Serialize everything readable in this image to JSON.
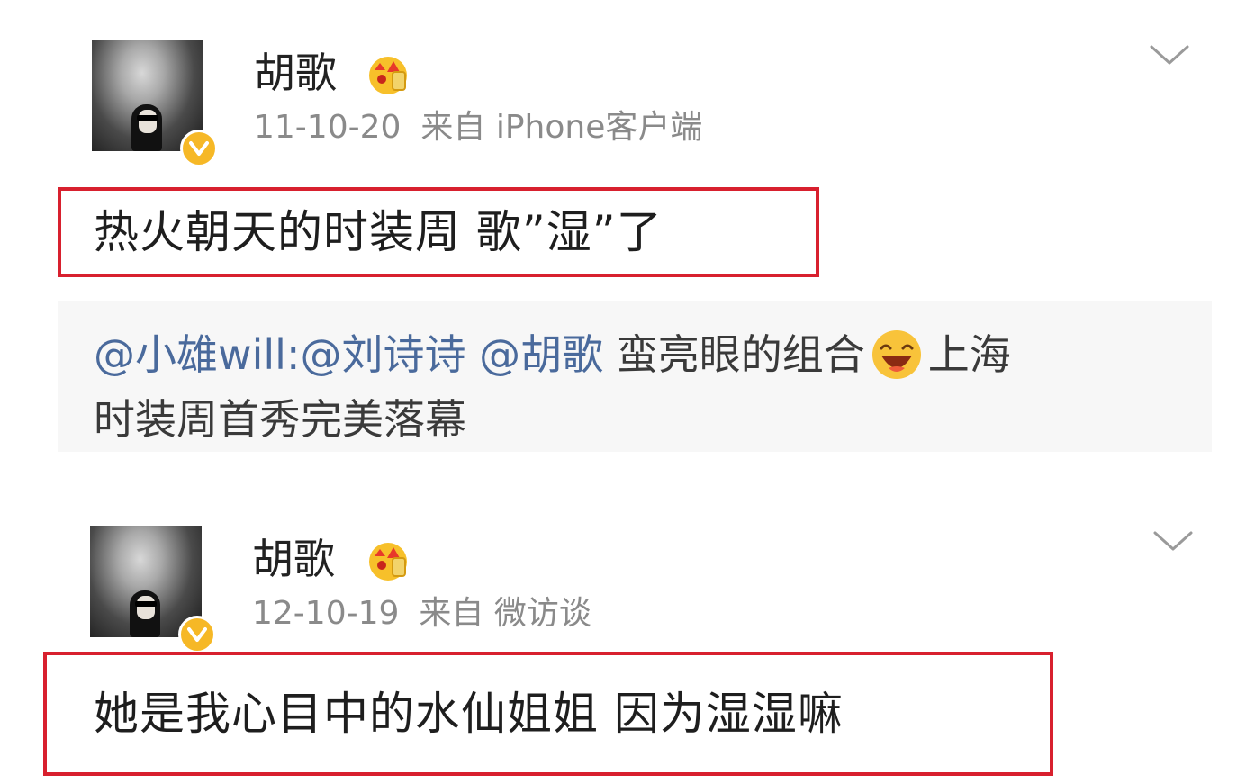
{
  "posts": [
    {
      "username": "胡歌",
      "date": "11-10-20",
      "source": "来自 iPhone客户端",
      "content": "热火朝天的时装周 歌”湿”了",
      "repost": {
        "mention1": "@小雄will:",
        "mention2": "@刘诗诗",
        "mention3": "@胡歌",
        "text_a": " 蛮亮眼的组合",
        "text_b": "上海",
        "text_c": "时装周首秀完美落幕",
        "emoji": "laughing-emoji"
      },
      "icons": {
        "badge": "verified-v-icon",
        "crown": "vip-crown-icon",
        "menu": "chevron-down-icon"
      }
    },
    {
      "username": "胡歌",
      "date": "12-10-19",
      "source": "来自 微访谈",
      "content": "她是我心目中的水仙姐姐 因为湿湿嘛",
      "icons": {
        "badge": "verified-v-icon",
        "crown": "vip-crown-icon",
        "menu": "chevron-down-icon"
      }
    }
  ],
  "colors": {
    "highlight_border": "#d8202e",
    "badge_gold": "#f6b826",
    "mention_blue": "#4a6a9c",
    "meta_gray": "#8a8a8a",
    "repost_bg": "#f7f7f7"
  }
}
